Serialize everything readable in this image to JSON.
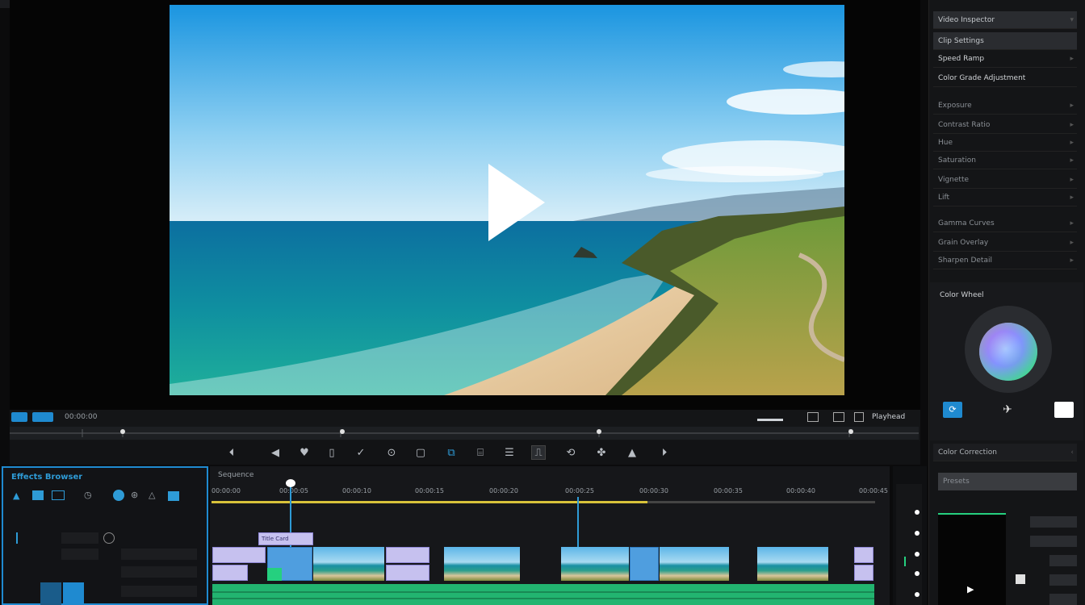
{
  "app": {
    "title": "",
    "header": ""
  },
  "viewer": {
    "scene": "coastal-beach-cliffs"
  },
  "transport": {
    "timecode": "00:00:00",
    "left_buttons": [
      "▣",
      "▣▣",
      "▯"
    ],
    "right_label": "Playhead"
  },
  "toolbar": {
    "tools": [
      "⏴",
      "◀",
      "♥",
      "▯",
      "✓",
      "⊙",
      "▢",
      "⧉",
      "⌸",
      "☰",
      "⎍",
      "⟲",
      "✤",
      "▲",
      "⏵"
    ]
  },
  "inspector": {
    "rows": [
      {
        "label": "Video Inspector",
        "selected": true
      },
      {
        "label": "Clip Settings",
        "selected": true
      },
      {
        "label": "Speed Ramp",
        "selected": false
      },
      {
        "label": "Color Grade Adjustment",
        "selected": false
      },
      {
        "label": "Exposure",
        "selected": false
      },
      {
        "label": "Contrast Ratio",
        "selected": false
      },
      {
        "label": "Hue",
        "selected": false
      },
      {
        "label": "Saturation",
        "selected": false
      },
      {
        "label": "Vignette",
        "selected": false
      },
      {
        "label": "Lift",
        "selected": false
      },
      {
        "label": "Gamma Curves",
        "selected": false
      },
      {
        "label": "Grain Overlay",
        "selected": false
      }
    ],
    "color_section": "Color Wheel",
    "bottom_label": "Color Correction",
    "preset_label": "Presets"
  },
  "effects": {
    "title": "Effects Browser"
  },
  "timeline": {
    "header": "Sequence",
    "ruler": [
      "00:00:00",
      "00:00:05",
      "00:00:10",
      "00:00:15",
      "00:00:20",
      "00:00:25",
      "00:00:30",
      "00:00:35",
      "00:00:40",
      "00:00:45"
    ],
    "marker_label": "Title Card"
  },
  "colors": {
    "accent": "#1f8ad0",
    "clip_purple": "#c6c1ef",
    "clip_blue": "#4f9edf",
    "clip_green": "#25d07f",
    "yellow_work": "#d8c23a"
  }
}
